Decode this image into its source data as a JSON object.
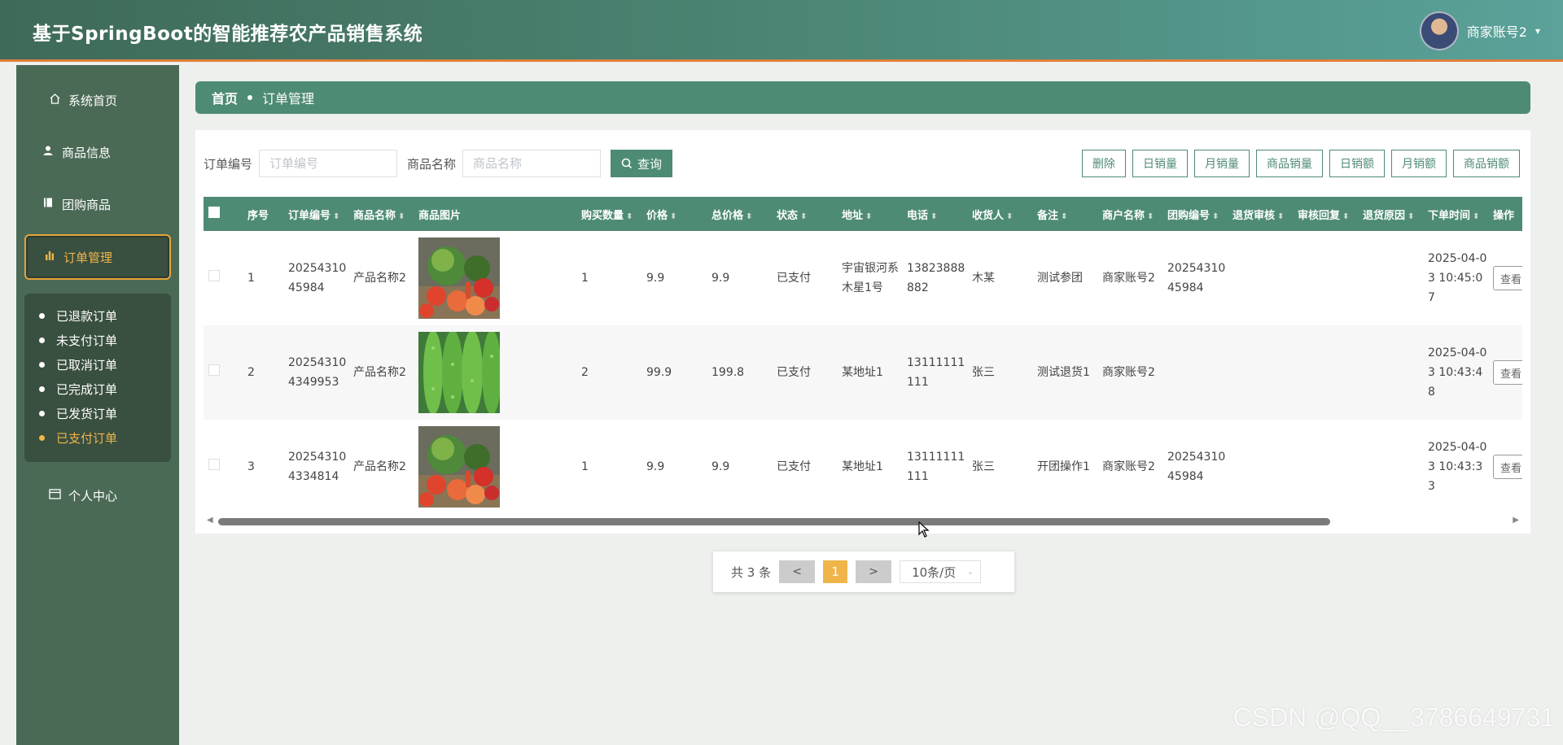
{
  "app": {
    "title": "基于SpringBoot的智能推荐农产品销售系统"
  },
  "user": {
    "name": "商家账号2",
    "caret": "▾"
  },
  "sidebar": {
    "items": [
      {
        "label": "系统首页",
        "icon": "home-icon"
      },
      {
        "label": "商品信息",
        "icon": "user-icon"
      },
      {
        "label": "团购商品",
        "icon": "book-icon"
      },
      {
        "label": "订单管理",
        "icon": "bar-chart-icon"
      },
      {
        "label": "个人中心",
        "icon": "card-icon"
      }
    ],
    "submenu": [
      "已退款订单",
      "未支付订单",
      "已取消订单",
      "已完成订单",
      "已发货订单",
      "已支付订单"
    ]
  },
  "breadcrumb": {
    "home": "首页",
    "current": "订单管理"
  },
  "search": {
    "order_no_label": "订单编号",
    "order_no_placeholder": "订单编号",
    "product_label": "商品名称",
    "product_placeholder": "商品名称",
    "query_label": "查询"
  },
  "toolbar": [
    "删除",
    "日销量",
    "月销量",
    "商品销量",
    "日销额",
    "月销额",
    "商品销额"
  ],
  "table": {
    "columns": [
      "序号",
      "订单编号",
      "商品名称",
      "商品图片",
      "购买数量",
      "价格",
      "总价格",
      "状态",
      "地址",
      "电话",
      "收货人",
      "备注",
      "商户名称",
      "团购编号",
      "退货审核",
      "审核回复",
      "退货原因",
      "下单时间",
      "操作"
    ],
    "rows": [
      {
        "idx": "1",
        "order_no": "2025431045984",
        "product": "产品名称2",
        "image": "vegetables-image",
        "qty": "1",
        "price": "9.9",
        "total": "9.9",
        "status": "已支付",
        "address": "宇宙银河系木星1号",
        "phone": "13823888882",
        "receiver": "木某",
        "remark": "测试参团",
        "merchant": "商家账号2",
        "group_no": "2025431045984",
        "return_review": "",
        "review_reply": "",
        "return_reason": "",
        "order_time": "2025-04-03 10:45:07",
        "action": "查看"
      },
      {
        "idx": "2",
        "order_no": "202543104349953",
        "product": "产品名称2",
        "image": "bitter-melon-image",
        "qty": "2",
        "price": "99.9",
        "total": "199.8",
        "status": "已支付",
        "address": "某地址1",
        "phone": "13111111111",
        "receiver": "张三",
        "remark": "测试退货1",
        "merchant": "商家账号2",
        "group_no": "",
        "return_review": "",
        "review_reply": "",
        "return_reason": "",
        "order_time": "2025-04-03 10:43:48",
        "action": "查看"
      },
      {
        "idx": "3",
        "order_no": "202543104334814",
        "product": "产品名称2",
        "image": "vegetables-image",
        "qty": "1",
        "price": "9.9",
        "total": "9.9",
        "status": "已支付",
        "address": "某地址1",
        "phone": "13111111111",
        "receiver": "张三",
        "remark": "开团操作1",
        "merchant": "商家账号2",
        "group_no": "2025431045984",
        "return_review": "",
        "review_reply": "",
        "return_reason": "",
        "order_time": "2025-04-03 10:43:33",
        "action": "查看"
      }
    ]
  },
  "pagination": {
    "total_text": "共 3 条",
    "prev": "<",
    "current": "1",
    "next": ">",
    "page_size": "10条/页"
  },
  "watermark": "CSDN @QQ__3786649731",
  "colors": {
    "primary": "#4e8b74",
    "accent": "#f0b54a",
    "sidebar": "#4b6a56",
    "header_border": "#e0803a"
  }
}
